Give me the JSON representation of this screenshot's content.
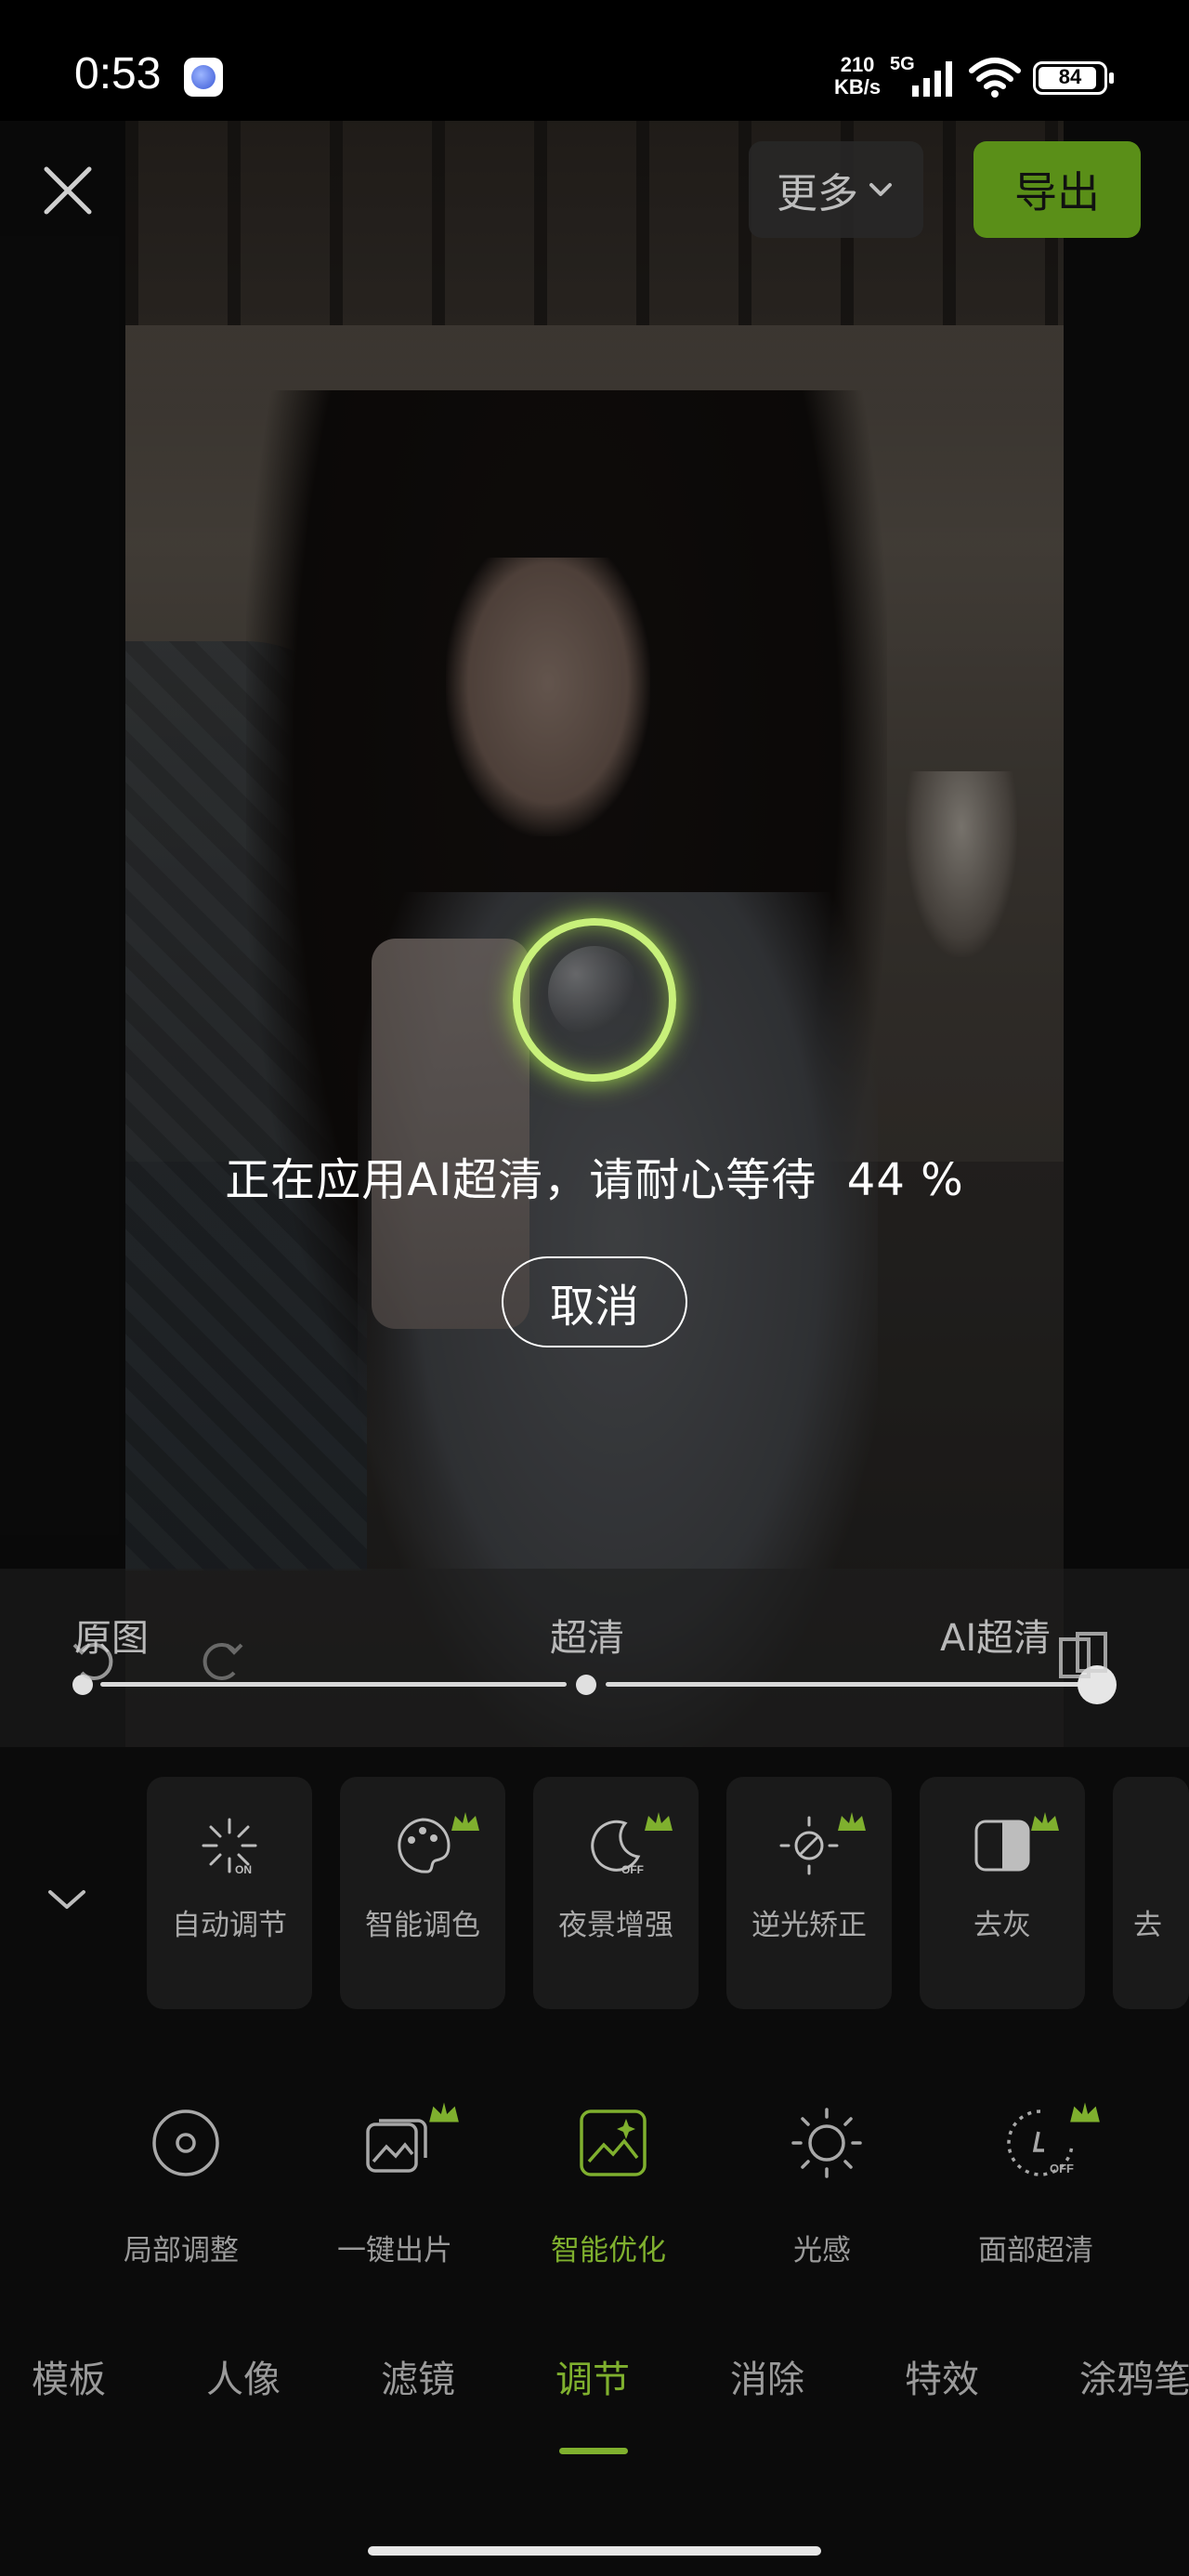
{
  "status_bar": {
    "time": "0:53",
    "net_speed_value": "210",
    "net_speed_unit": "KB/s",
    "network": "5G",
    "battery_level": "84"
  },
  "header": {
    "more_label": "更多",
    "export_label": "导出"
  },
  "processing": {
    "message": "正在应用AI超清，请耐心等待",
    "percent": "44 %",
    "percent_value": 44,
    "cancel_label": "取消"
  },
  "compare_slider": {
    "labels": [
      "原图",
      "超清",
      "AI超清"
    ]
  },
  "smart_tools": [
    {
      "label": "自动调节",
      "icon": "auto-adjust-icon",
      "premium": false
    },
    {
      "label": "智能调色",
      "icon": "palette-icon",
      "premium": true
    },
    {
      "label": "夜景增强",
      "icon": "night-moon-icon",
      "premium": true
    },
    {
      "label": "逆光矫正",
      "icon": "backlight-sun-icon",
      "premium": true
    },
    {
      "label": "去灰",
      "icon": "dehaze-icon",
      "premium": true
    },
    {
      "label": "去",
      "icon": "partial-tool-icon",
      "premium": false
    }
  ],
  "features": [
    {
      "label": "局部调整",
      "icon": "local-adjust-icon",
      "premium": false,
      "active": false
    },
    {
      "label": "一键出片",
      "icon": "one-click-photo-icon",
      "premium": true,
      "active": false
    },
    {
      "label": "智能优化",
      "icon": "smart-optimize-icon",
      "premium": false,
      "active": true
    },
    {
      "label": "光感",
      "icon": "light-sense-icon",
      "premium": false,
      "active": false
    },
    {
      "label": "面部超清",
      "icon": "face-hd-icon",
      "premium": true,
      "active": false
    }
  ],
  "tabs": [
    {
      "label": "模板",
      "active": false
    },
    {
      "label": "人像",
      "active": false
    },
    {
      "label": "滤镜",
      "active": false
    },
    {
      "label": "调节",
      "active": true
    },
    {
      "label": "消除",
      "active": false
    },
    {
      "label": "特效",
      "active": false
    },
    {
      "label": "涂鸦笔",
      "active": false
    }
  ],
  "colors": {
    "accent": "#7fb02e",
    "export_bg": "#5a8f18",
    "loader_glow": "#c8f07a"
  }
}
